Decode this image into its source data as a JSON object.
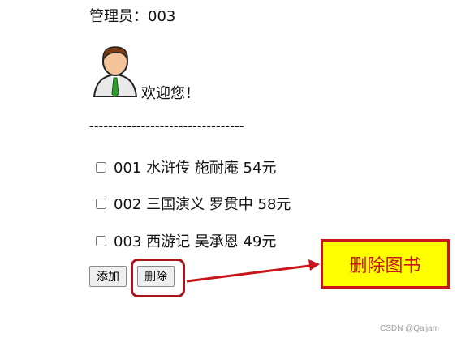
{
  "admin_label": "管理员：003",
  "welcome": "欢迎您！",
  "divider": "---------------------------------",
  "books": [
    {
      "label": "001 水浒传 施耐庵 54元",
      "checked": false
    },
    {
      "label": "002 三国演义 罗贯中 58元",
      "checked": false
    },
    {
      "label": "003 西游记 吴承恩 49元",
      "checked": false
    }
  ],
  "buttons": {
    "add": "添加",
    "delete": "删除"
  },
  "callout": "删除图书",
  "watermark": "CSDN @Qaijam",
  "colors": {
    "highlight": "#a9141c",
    "callout_bg": "#ffff00",
    "callout_text": "#c8141a"
  }
}
